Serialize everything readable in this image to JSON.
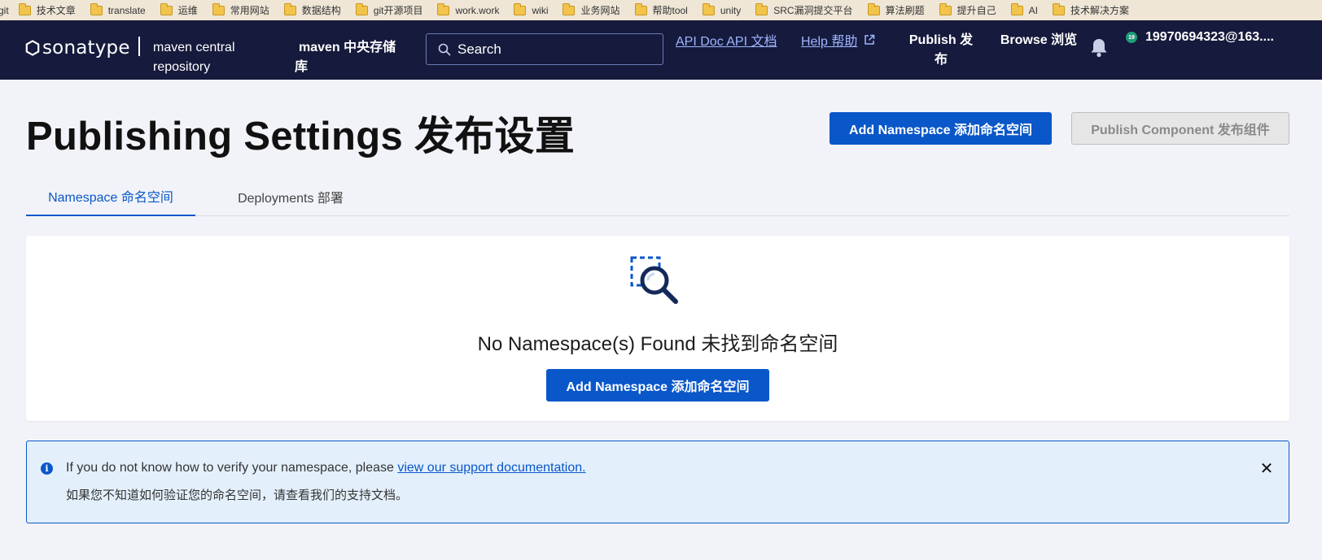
{
  "bookmarks": [
    {
      "label": "git"
    },
    {
      "label": "技术文章"
    },
    {
      "label": "translate"
    },
    {
      "label": "运维"
    },
    {
      "label": "常用网站"
    },
    {
      "label": "数据结构"
    },
    {
      "label": "git开源项目"
    },
    {
      "label": "work.work"
    },
    {
      "label": "wiki"
    },
    {
      "label": "业务网站"
    },
    {
      "label": "帮助tool"
    },
    {
      "label": "unity"
    },
    {
      "label": "SRC漏洞提交平台"
    },
    {
      "label": "算法刷题"
    },
    {
      "label": "提升自己"
    },
    {
      "label": "AI"
    },
    {
      "label": "技术解决方案"
    }
  ],
  "header": {
    "logo_text": "sonatype",
    "repo_label": "maven central repository",
    "repo_label_cn": "maven 中央存储库",
    "search_placeholder": "Search",
    "api_doc_link": "API Doc API 文档",
    "help_link": "Help 帮助",
    "publish_nav": "Publish 发布",
    "browse_nav": "Browse 浏览",
    "user_email": "19970694323@163....",
    "avatar_initial": "19"
  },
  "page": {
    "title": "Publishing Settings 发布设置",
    "add_namespace_button": "Add Namespace 添加命名空间",
    "publish_component_button": "Publish Component 发布组件"
  },
  "tabs": [
    {
      "label": "Namespace 命名空间",
      "active": true
    },
    {
      "label": "Deployments 部署",
      "active": false
    }
  ],
  "empty_state": {
    "message": "No Namespace(s) Found 未找到命名空间",
    "button": "Add Namespace 添加命名空间"
  },
  "alert": {
    "text_prefix": "If you do not know how to verify your namespace, please ",
    "link_text": "view our support documentation.",
    "text_cn": "如果您不知道如何验证您的命名空间，请查看我们的支持文档。",
    "close_symbol": "✕"
  },
  "colors": {
    "header_bg": "#161a3c",
    "primary": "#0a57c9",
    "page_bg": "#f2f3f8",
    "alert_bg": "#e3f0fc"
  }
}
